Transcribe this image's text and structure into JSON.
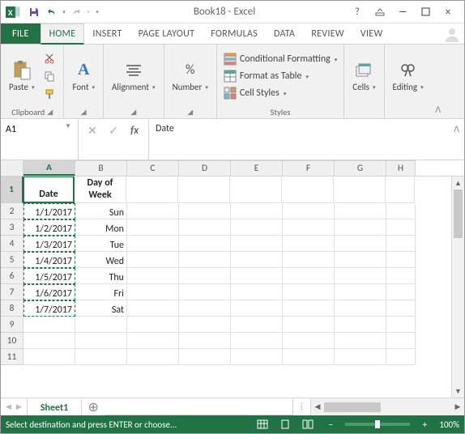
{
  "title": "Book18 - Excel",
  "tabs": {
    "file": "FILE",
    "home": "HOME",
    "insert": "INSERT",
    "pagelayout": "PAGE LAYOUT",
    "formulas": "FORMULAS",
    "data": "DATA",
    "review": "REVIEW",
    "view": "VIEW"
  },
  "ribbon": {
    "clipboard": {
      "label": "Clipboard",
      "paste": "Paste"
    },
    "font": {
      "label": "Font"
    },
    "alignment": {
      "label": "Alignment"
    },
    "number": {
      "label": "Number"
    },
    "styles": {
      "label": "Styles",
      "cond": "Conditional Formatting",
      "fmt": "Format as Table",
      "cell": "Cell Styles"
    },
    "cells": {
      "label": "Cells"
    },
    "editing": {
      "label": "Editing"
    }
  },
  "formula_bar": {
    "name_box": "A1",
    "formula": "Date"
  },
  "columns": [
    "A",
    "B",
    "C",
    "D",
    "E",
    "F",
    "G",
    "H"
  ],
  "sheet": {
    "headers": {
      "A": "Date",
      "B": "Day of Week"
    },
    "rows": [
      {
        "A": "1/1/2017",
        "B": "Sun"
      },
      {
        "A": "1/2/2017",
        "B": "Mon"
      },
      {
        "A": "1/3/2017",
        "B": "Tue"
      },
      {
        "A": "1/4/2017",
        "B": "Wed"
      },
      {
        "A": "1/5/2017",
        "B": "Thu"
      },
      {
        "A": "1/6/2017",
        "B": "Fri"
      },
      {
        "A": "1/7/2017",
        "B": "Sat"
      }
    ]
  },
  "sheet_tab": "Sheet1",
  "status": {
    "msg": "Select destination and press ENTER or choose...",
    "zoom": "100%"
  }
}
